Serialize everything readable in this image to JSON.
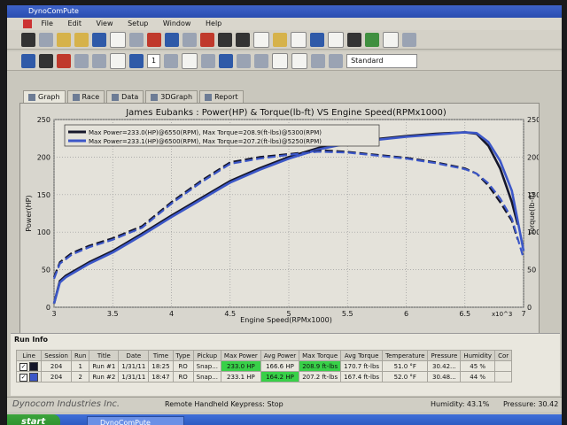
{
  "window": {
    "title": "DynoComPute",
    "menu": [
      "File",
      "Edit",
      "View",
      "Setup",
      "Window",
      "Help"
    ],
    "zoom_select": "1",
    "view_select": "Standard"
  },
  "tabs": [
    "Graph",
    "Race",
    "Data",
    "3DGraph",
    "Report"
  ],
  "chart_data": {
    "type": "line",
    "title": "James Eubanks : Power(HP) & Torque(lb-ft) VS Engine Speed(RPMx1000)",
    "xlabel": "Engine Speed(RPMx1000)",
    "ylabel_left": "Power(HP)",
    "ylabel_right": "Torque(lb-ft)",
    "x_unit_suffix": "x10^3",
    "xlim": [
      3,
      7
    ],
    "ylim": [
      0,
      250
    ],
    "xticks": [
      "3",
      "3.5",
      "4",
      "4.5",
      "5",
      "5.5",
      "6",
      "6.5",
      "7"
    ],
    "yticks_left": [
      "0",
      "50",
      "100",
      "150",
      "200",
      "250"
    ],
    "yticks_right": [
      "0",
      "50",
      "100",
      "150",
      "200",
      "250"
    ],
    "grid": true,
    "legend_position": "top-left",
    "legend": [
      "Max Power=233.0(HP)@6550(RPM), Max Torque=208.9(ft-lbs)@5300(RPM)",
      "Max Power=233.1(HP)@6500(RPM), Max Torque=207.2(ft-lbs)@5250(RPM)"
    ],
    "series": [
      {
        "name": "Run #1 Power",
        "color": "#15162a",
        "dash": false,
        "x": [
          3.0,
          3.05,
          3.1,
          3.3,
          3.5,
          3.75,
          4.0,
          4.25,
          4.5,
          4.75,
          5.0,
          5.25,
          5.5,
          5.75,
          6.0,
          6.25,
          6.5,
          6.6,
          6.7,
          6.8,
          6.9,
          6.95
        ],
        "y": [
          5,
          35,
          42,
          60,
          75,
          98,
          122,
          145,
          168,
          185,
          200,
          212,
          219,
          224,
          228,
          231,
          233,
          231,
          215,
          185,
          140,
          110
        ]
      },
      {
        "name": "Run #2 Power",
        "color": "#3c57c8",
        "dash": false,
        "x": [
          3.0,
          3.05,
          3.1,
          3.3,
          3.5,
          3.75,
          4.0,
          4.25,
          4.5,
          4.75,
          5.0,
          5.25,
          5.5,
          5.75,
          6.0,
          6.25,
          6.5,
          6.6,
          6.7,
          6.8,
          6.9,
          7.0
        ],
        "y": [
          5,
          33,
          40,
          58,
          73,
          96,
          120,
          143,
          166,
          183,
          198,
          210,
          218,
          223,
          227,
          230,
          233,
          232,
          220,
          195,
          155,
          75
        ]
      },
      {
        "name": "Run #1 Torque",
        "color": "#15162a",
        "dash": true,
        "x": [
          3.0,
          3.05,
          3.15,
          3.3,
          3.5,
          3.75,
          4.0,
          4.25,
          4.5,
          4.75,
          5.0,
          5.3,
          5.5,
          5.75,
          6.0,
          6.25,
          6.5,
          6.6,
          6.7,
          6.8,
          6.9,
          6.95
        ],
        "y": [
          40,
          60,
          72,
          82,
          92,
          108,
          140,
          168,
          193,
          200,
          204,
          208.9,
          207,
          203,
          199,
          193,
          185,
          178,
          162,
          140,
          115,
          90
        ]
      },
      {
        "name": "Run #2 Torque",
        "color": "#3c57c8",
        "dash": true,
        "x": [
          3.0,
          3.05,
          3.15,
          3.3,
          3.5,
          3.75,
          4.0,
          4.25,
          4.5,
          4.75,
          5.0,
          5.25,
          5.5,
          5.75,
          6.0,
          6.25,
          6.5,
          6.6,
          6.7,
          6.8,
          6.9,
          7.0
        ],
        "y": [
          38,
          58,
          70,
          80,
          90,
          106,
          138,
          166,
          191,
          198,
          203,
          207.2,
          206,
          202,
          198,
          192,
          184,
          178,
          165,
          145,
          118,
          65
        ]
      }
    ]
  },
  "run_info": {
    "title": "Run Info",
    "columns": [
      "Line",
      "Session",
      "Run",
      "Title",
      "Date",
      "Time",
      "Type",
      "Pickup",
      "Max Power",
      "Avg Power",
      "Max Torque",
      "Avg Torque",
      "Temperature",
      "Pressure",
      "Humidity",
      "Cor"
    ],
    "rows": [
      {
        "session": "204",
        "run": "1",
        "title": "Run #1",
        "date": "1/31/11",
        "time": "18:25",
        "type": "RO",
        "pickup": "Snap...",
        "max_power": "233.0 HP",
        "avg_power": "166.6 HP",
        "max_torque": "208.9 ft-lbs",
        "avg_torque": "170.7 ft-lbs",
        "temperature": "51.0 °F",
        "pressure": "30.42...",
        "humidity": "45 %",
        "swatch": "#15162a"
      },
      {
        "session": "204",
        "run": "2",
        "title": "Run #2",
        "date": "1/31/11",
        "time": "18:47",
        "type": "RO",
        "pickup": "Snap...",
        "max_power": "233.1 HP",
        "avg_power": "164.2 HP",
        "max_torque": "207.2 ft-lbs",
        "avg_torque": "167.4 ft-lbs",
        "temperature": "52.0 °F",
        "pressure": "30.48...",
        "humidity": "44 %",
        "swatch": "#3c57c8"
      }
    ]
  },
  "status": {
    "company": "Dynocom Industries Inc.",
    "keypress": "Remote Handheld Keypress: Stop",
    "humidity": "Humidity: 43.1%",
    "pressure": "Pressure: 30.42"
  },
  "taskbar": {
    "start": "start",
    "item": "DynoComPute"
  }
}
